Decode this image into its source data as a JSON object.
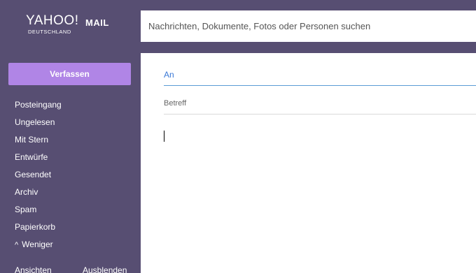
{
  "header": {
    "logo_main": "YAHOO!",
    "logo_mail": "MAIL",
    "logo_sub": "DEUTSCHLAND",
    "search_placeholder": "Nachrichten, Dokumente, Fotos oder Personen suchen",
    "background_color": "#574e72"
  },
  "sidebar": {
    "compose_label": "Verfassen",
    "compose_color": "#b085e6",
    "items": [
      {
        "label": "Posteingang"
      },
      {
        "label": "Ungelesen"
      },
      {
        "label": "Mit Stern"
      },
      {
        "label": "Entwürfe"
      },
      {
        "label": "Gesendet"
      },
      {
        "label": "Archiv"
      },
      {
        "label": "Spam"
      },
      {
        "label": "Papierkorb"
      },
      {
        "label": "Weniger",
        "icon": "chevron-up-icon"
      }
    ],
    "footer": {
      "left": "Ansichten",
      "right": "Ausblenden"
    }
  },
  "compose": {
    "to_label": "An",
    "subject_label": "Betreff"
  }
}
